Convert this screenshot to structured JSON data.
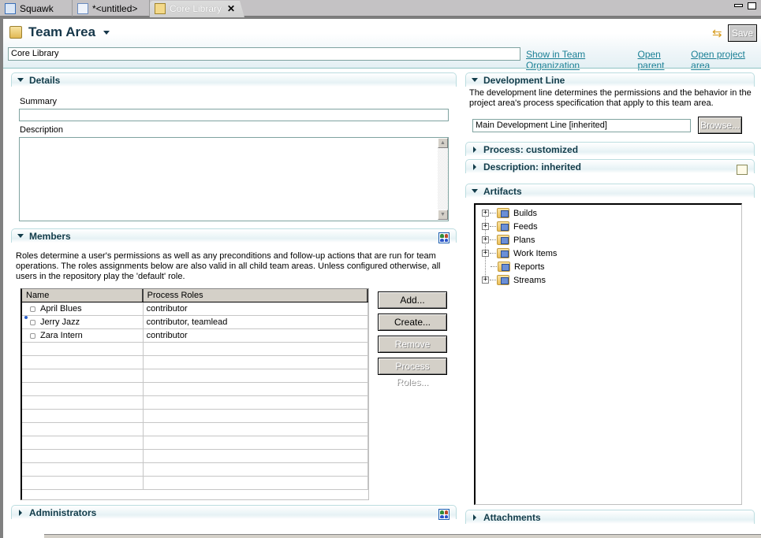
{
  "tabs": [
    {
      "label": "Squawk",
      "icon": "team-org-icon",
      "active": false
    },
    {
      "label": "*<untitled>",
      "icon": "work-item-edit-icon",
      "active": false
    },
    {
      "label": "Core Library",
      "icon": "team-area-icon",
      "active": true,
      "close_icon": "close-icon"
    }
  ],
  "window_controls": {
    "minimize": "minimize-icon",
    "maximize": "maximize-icon"
  },
  "header": {
    "title": "Team Area",
    "name_value": "Core Library",
    "save_label": "Save",
    "links": [
      "Show in Team Organization",
      "Open parent",
      "Open project area"
    ]
  },
  "details": {
    "title": "Details",
    "summary_label": "Summary",
    "summary_value": "",
    "description_label": "Description",
    "description_value": ""
  },
  "members": {
    "title": "Members",
    "description": "Roles determine a user's permissions as well as any preconditions and follow-up actions that are run for team operations. The roles assignments below are also valid in all child team areas. Unless configured otherwise, all users in the repository play the 'default' role.",
    "columns": [
      "Name",
      "Process Roles"
    ],
    "rows": [
      {
        "name": "April Blues",
        "roles": "contributor",
        "team_lead": false
      },
      {
        "name": "Jerry Jazz",
        "roles": "contributor, teamlead",
        "team_lead": true
      },
      {
        "name": "Zara Intern",
        "roles": "contributor",
        "team_lead": false
      }
    ],
    "buttons": {
      "add": "Add...",
      "create": "Create...",
      "remove": "Remove",
      "process_roles": "Process Roles..."
    }
  },
  "administrators": {
    "title": "Administrators"
  },
  "development_line": {
    "title": "Development Line",
    "description": "The development line determines the permissions and the behavior in the project area's process specification that apply to this team area.",
    "value": "Main Development Line [inherited]",
    "browse_label": "Browse..."
  },
  "process": {
    "title": "Process: customized"
  },
  "description_section": {
    "title": "Description: inherited"
  },
  "artifacts": {
    "title": "Artifacts",
    "items": [
      {
        "label": "Builds",
        "expandable": true
      },
      {
        "label": "Feeds",
        "expandable": true
      },
      {
        "label": "Plans",
        "expandable": true
      },
      {
        "label": "Work Items",
        "expandable": true
      },
      {
        "label": "Reports",
        "expandable": false
      },
      {
        "label": "Streams",
        "expandable": true
      }
    ]
  },
  "attachments": {
    "title": "Attachments"
  }
}
